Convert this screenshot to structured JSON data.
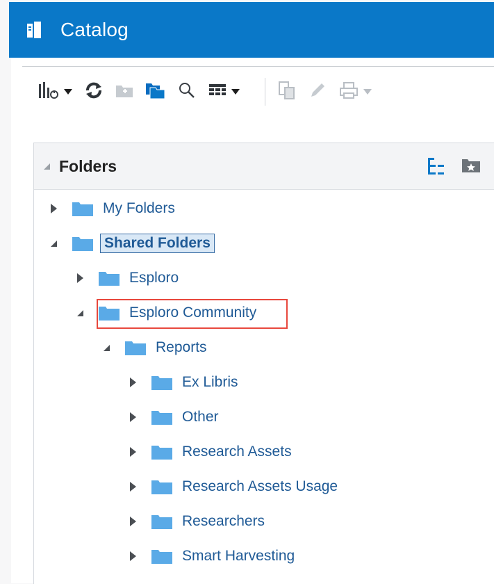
{
  "header": {
    "title": "Catalog",
    "background": "#0a78c8",
    "icon": "catalog-book-icon"
  },
  "toolbar": {
    "buttons": [
      {
        "name": "new-dropdown",
        "icon": "new-chart-icon",
        "has_caret": true,
        "enabled": true
      },
      {
        "name": "refresh",
        "icon": "refresh-icon",
        "enabled": true
      },
      {
        "name": "new-folder",
        "icon": "new-folder-icon",
        "enabled": false
      },
      {
        "name": "show-folders",
        "icon": "folders-icon",
        "enabled": true
      },
      {
        "name": "search",
        "icon": "search-icon",
        "enabled": true
      },
      {
        "name": "view-dropdown",
        "icon": "view-grid-icon",
        "has_caret": true,
        "enabled": true
      },
      {
        "name": "copy",
        "icon": "copy-icon",
        "enabled": false
      },
      {
        "name": "edit",
        "icon": "edit-pencil-icon",
        "enabled": false
      },
      {
        "name": "print",
        "icon": "print-icon",
        "has_caret": true,
        "enabled": false
      }
    ]
  },
  "panel": {
    "title": "Folders",
    "header_icons": [
      "tree-view-icon",
      "favorite-folder-icon"
    ]
  },
  "tree": [
    {
      "label": "My Folders",
      "depth": 0,
      "state": "collapsed"
    },
    {
      "label": "Shared Folders",
      "depth": 0,
      "state": "expanded",
      "selected": true
    },
    {
      "label": "Esploro",
      "depth": 1,
      "state": "collapsed"
    },
    {
      "label": "Esploro Community",
      "depth": 1,
      "state": "expanded",
      "highlighted": true
    },
    {
      "label": "Reports",
      "depth": 2,
      "state": "expanded"
    },
    {
      "label": "Ex Libris",
      "depth": 3,
      "state": "collapsed"
    },
    {
      "label": "Other",
      "depth": 3,
      "state": "collapsed"
    },
    {
      "label": "Research Assets",
      "depth": 3,
      "state": "collapsed"
    },
    {
      "label": "Research Assets Usage",
      "depth": 3,
      "state": "collapsed"
    },
    {
      "label": "Researchers",
      "depth": 3,
      "state": "collapsed"
    },
    {
      "label": "Smart Harvesting",
      "depth": 3,
      "state": "collapsed"
    }
  ],
  "colors": {
    "link_text": "#1f5a96",
    "folder": "#5aaae6",
    "highlight_border": "#e8483d",
    "selection_fill": "#d9e8f6"
  }
}
